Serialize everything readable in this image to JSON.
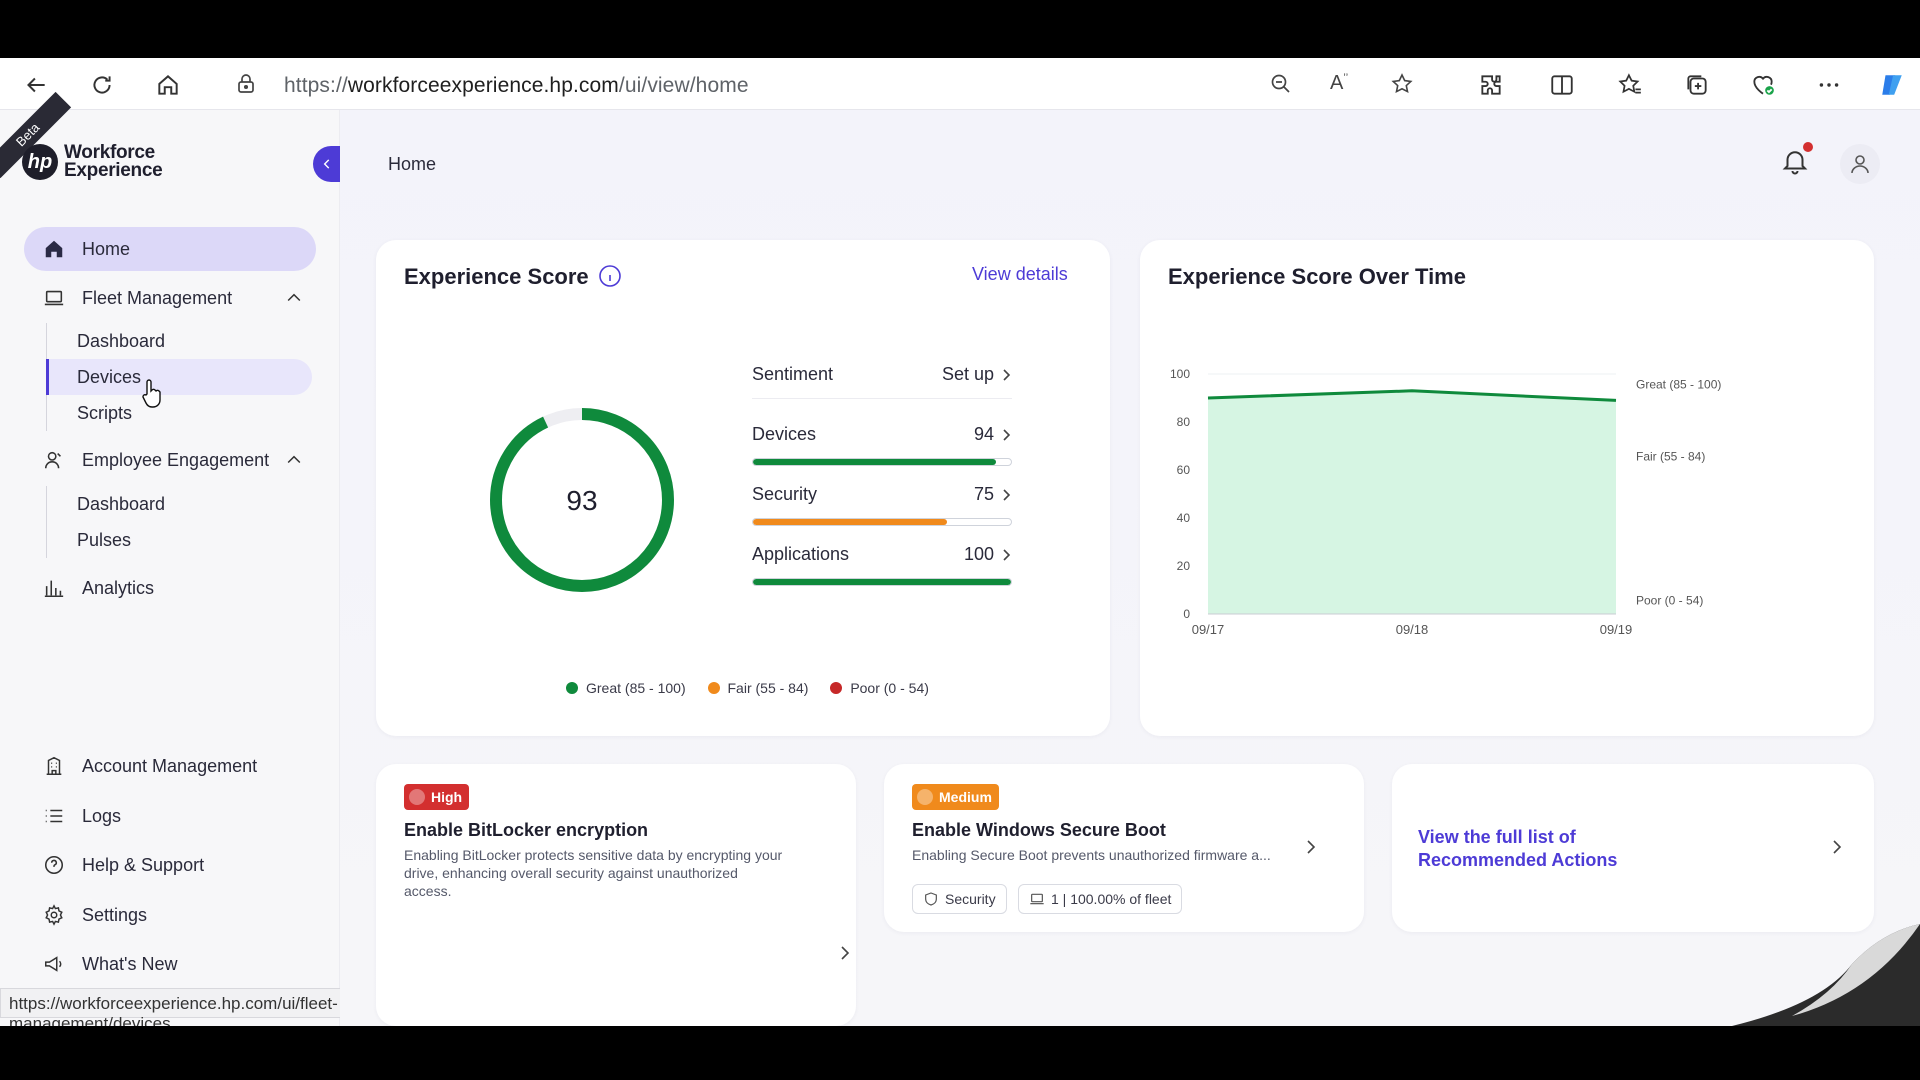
{
  "browser": {
    "url_prefix": "https://",
    "url_domain": "workforceexperience.hp.com",
    "url_path": "/ui/view/home",
    "status_url": "https://workforceexperience.hp.com/ui/fleet-management/devices"
  },
  "sidebar": {
    "beta_label": "Beta",
    "logo_mark": "hp",
    "logo_line1": "Workforce",
    "logo_line2": "Experience",
    "home": "Home",
    "fleet_management": "Fleet Management",
    "fleet_sub": [
      "Dashboard",
      "Devices",
      "Scripts"
    ],
    "employee_engagement": "Employee Engagement",
    "employee_sub": [
      "Dashboard",
      "Pulses"
    ],
    "analytics": "Analytics",
    "account_management": "Account Management",
    "logs": "Logs",
    "help_support": "Help & Support",
    "settings": "Settings",
    "whats_new": "What's New"
  },
  "header": {
    "breadcrumb": "Home"
  },
  "score_card": {
    "title": "Experience Score",
    "view_details": "View details",
    "score": "93",
    "score_value": 93,
    "metrics": [
      {
        "label": "Sentiment",
        "value": "Set up",
        "fill": null
      },
      {
        "label": "Devices",
        "value": "94",
        "fill": 94,
        "color": "#0f8a3c"
      },
      {
        "label": "Security",
        "value": "75",
        "fill": 75,
        "color": "#f08a1c"
      },
      {
        "label": "Applications",
        "value": "100",
        "fill": 100,
        "color": "#0f8a3c"
      }
    ],
    "legend": [
      {
        "label": "Great (85 - 100)",
        "color": "#0f8a3c"
      },
      {
        "label": "Fair (55 - 84)",
        "color": "#f08a1c"
      },
      {
        "label": "Poor (0 - 54)",
        "color": "#c62828"
      }
    ]
  },
  "chart_card": {
    "title": "Experience Score Over Time"
  },
  "chart_data": {
    "type": "area",
    "title": "Experience Score Over Time",
    "x": [
      "09/17",
      "09/18",
      "09/19"
    ],
    "values": [
      90,
      93,
      89
    ],
    "ylim": [
      0,
      100
    ],
    "yticks": [
      "0",
      "20",
      "40",
      "60",
      "80",
      "100"
    ],
    "bands": [
      "Great (85 - 100)",
      "Fair (55 - 84)",
      "Poor (0 - 54)"
    ],
    "colors": {
      "line": "#0f8a3c",
      "fill": "#d6f5e3"
    }
  },
  "recommendations": [
    {
      "severity": "High",
      "severity_color": "#d32f2f",
      "title": "Enable BitLocker encryption",
      "desc": "Enabling BitLocker protects sensitive data by encrypting your drive, enhancing overall security against unauthorized access."
    },
    {
      "severity": "Medium",
      "severity_color": "#f08a1c",
      "title": "Enable Windows Secure Boot",
      "desc": "Enabling Secure Boot prevents unauthorized firmware a...",
      "tag_category": "Security",
      "tag_fleet": "1 | 100.00% of fleet"
    }
  ],
  "view_full_list": "View the full list of Recommended Actions",
  "colors": {
    "accent": "#4d3bd6",
    "great": "#0f8a3c",
    "fair": "#f08a1c",
    "poor": "#c62828"
  }
}
